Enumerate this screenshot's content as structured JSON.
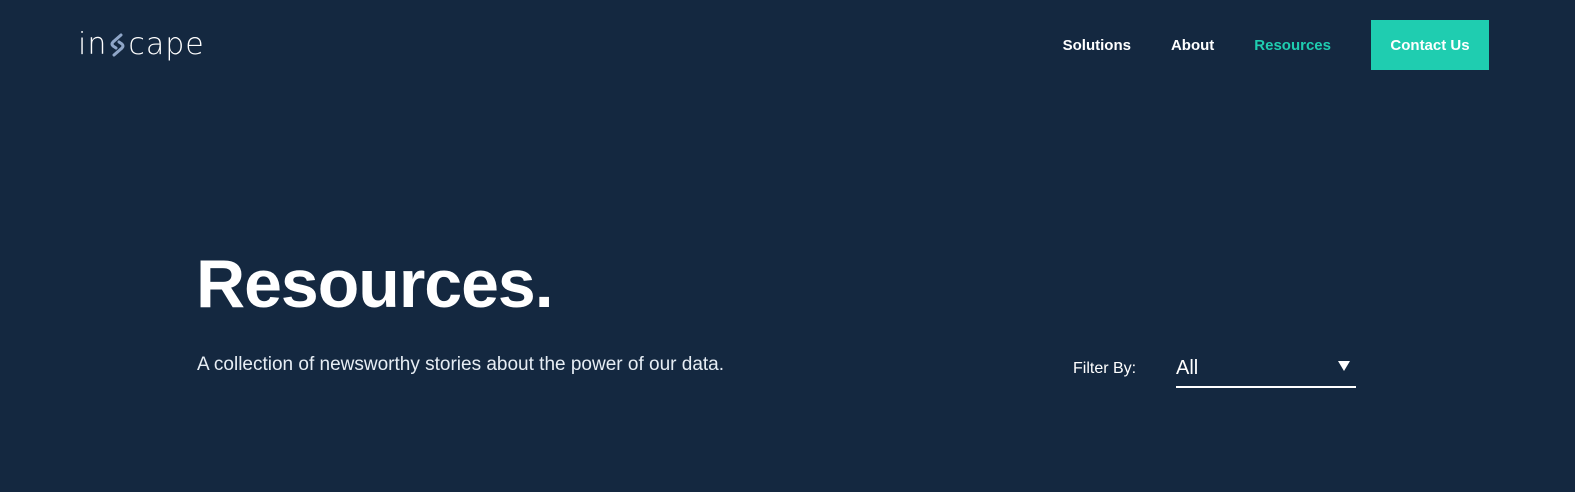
{
  "brand": {
    "logo_text_left": "in",
    "logo_text_right": "cape",
    "accent_color": "#1fcdb0",
    "background_color": "#142840",
    "logo_mark_color": "#8fa6c8"
  },
  "nav": {
    "items": [
      {
        "label": "Solutions",
        "active": false
      },
      {
        "label": "About",
        "active": false
      },
      {
        "label": "Resources",
        "active": true
      }
    ],
    "cta_label": "Contact Us"
  },
  "hero": {
    "title": "Resources.",
    "subtitle": "A collection of newsworthy stories about the power of our data."
  },
  "filter": {
    "label": "Filter By:",
    "selected": "All",
    "icon": "triangle-down-icon"
  }
}
